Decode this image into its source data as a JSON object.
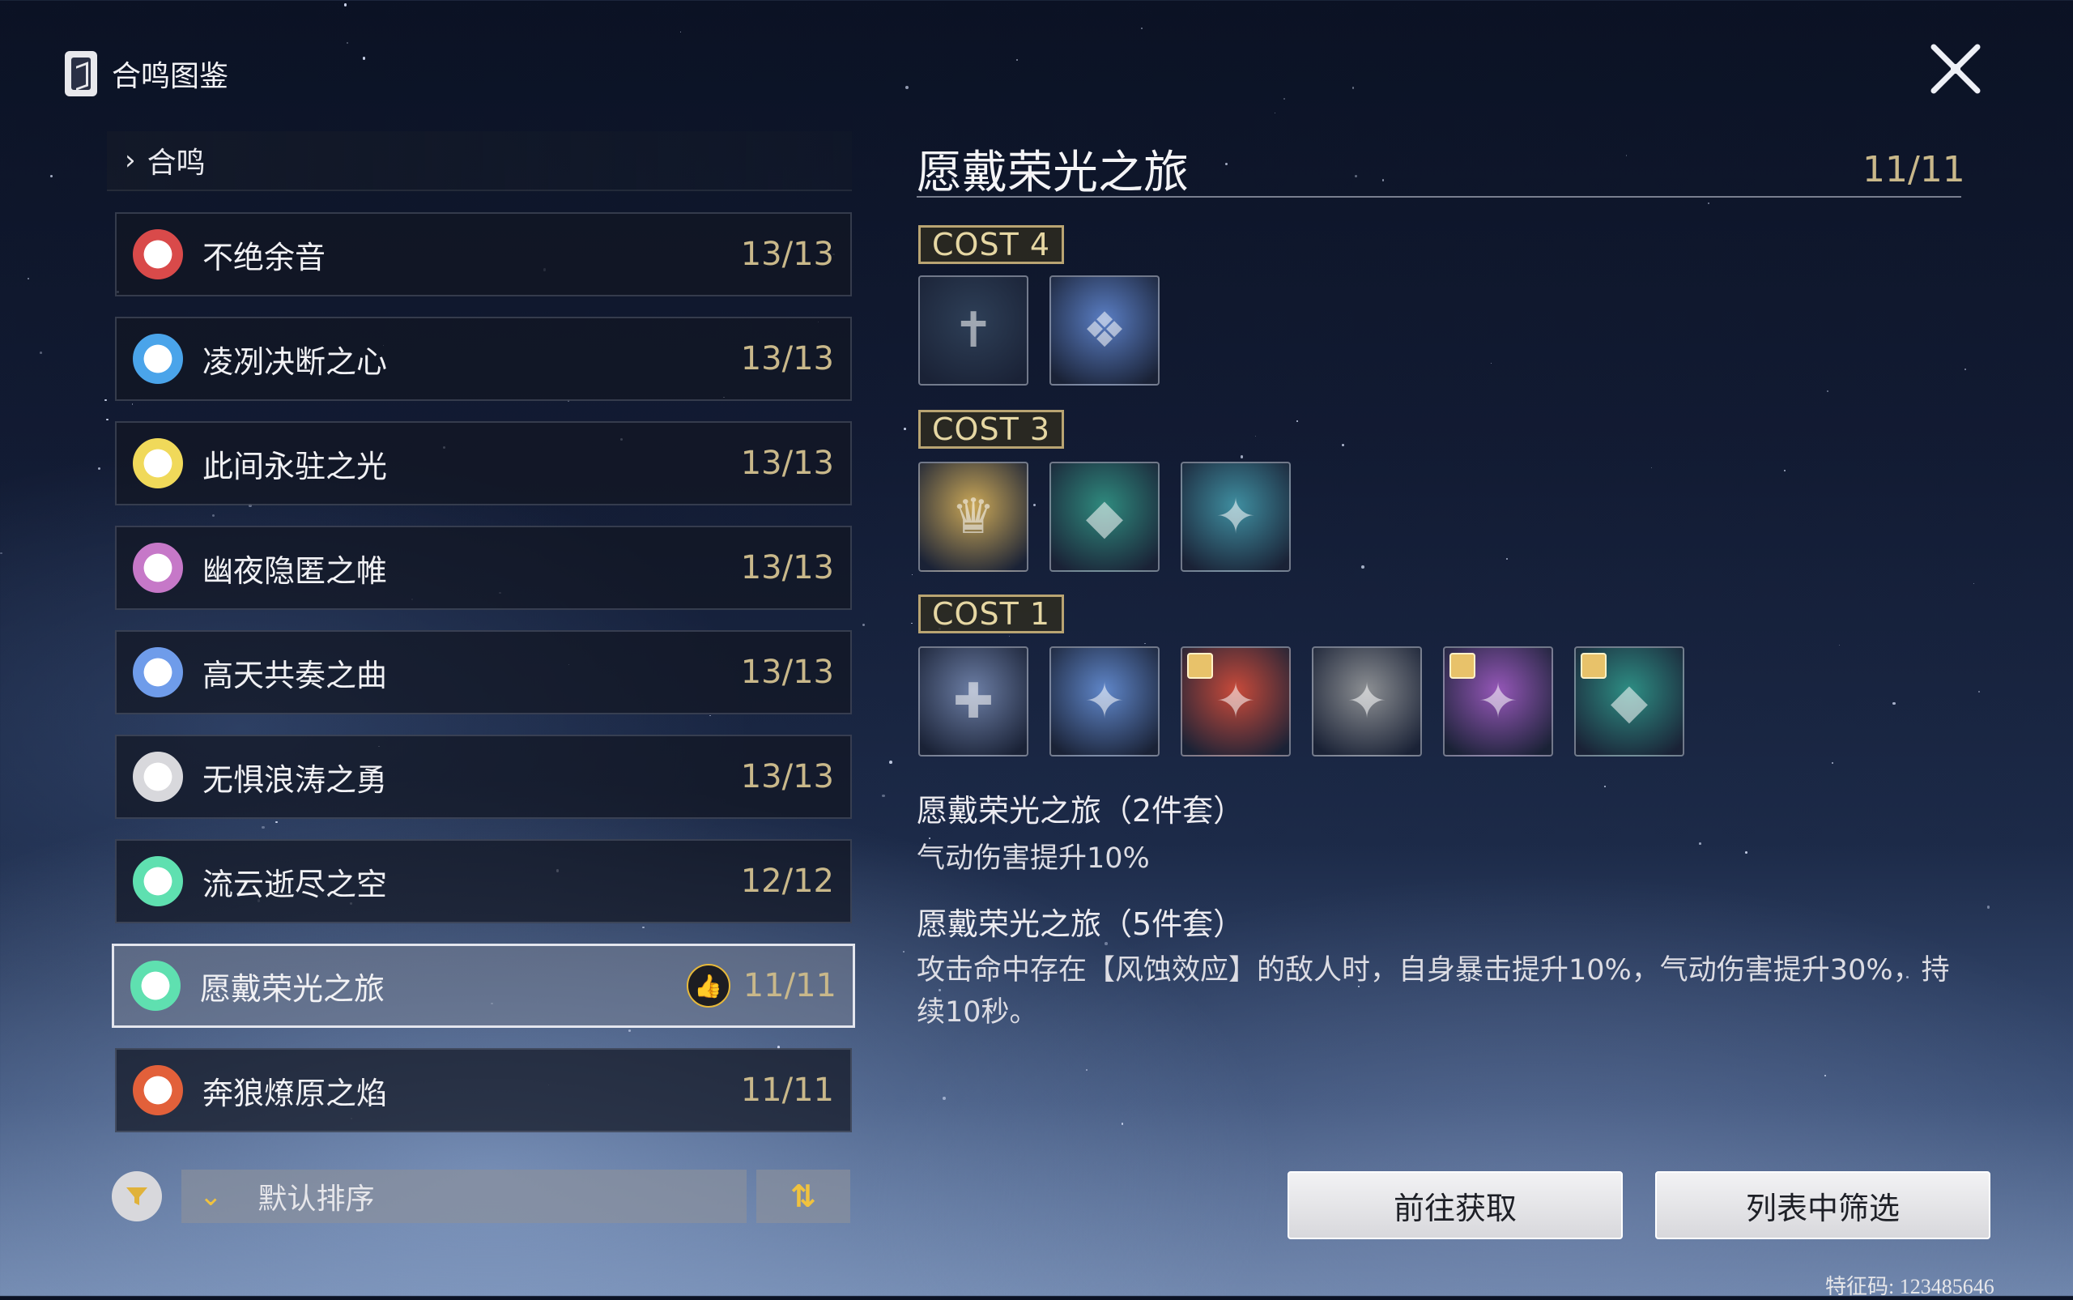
{
  "header": {
    "title": "合鸣图鉴",
    "icon": "codex-icon"
  },
  "list": {
    "category": "合鸣",
    "sets": [
      {
        "name": "不绝余音",
        "count": "13/13",
        "color": "#d94a4a",
        "icon": "sword-cross-icon"
      },
      {
        "name": "凌冽决断之心",
        "count": "13/13",
        "color": "#4aa4ea",
        "icon": "ice-star-icon"
      },
      {
        "name": "此间永驻之光",
        "count": "13/13",
        "color": "#f0d95a",
        "icon": "sun-icon"
      },
      {
        "name": "幽夜隐匿之帷",
        "count": "13/13",
        "color": "#c678c8",
        "icon": "shadow-icon"
      },
      {
        "name": "高天共奏之曲",
        "count": "13/13",
        "color": "#6f9cea",
        "icon": "sparkle-icon"
      },
      {
        "name": "无惧浪涛之勇",
        "count": "13/13",
        "color": "#d8d8dc",
        "icon": "wave-icon"
      },
      {
        "name": "流云逝尽之空",
        "count": "12/12",
        "color": "#5fe0b0",
        "icon": "wing-icon"
      },
      {
        "name": "愿戴荣光之旅",
        "count": "11/11",
        "color": "#5fe0b0",
        "icon": "fleur-icon",
        "selected": true,
        "recommended": true
      },
      {
        "name": "奔狼燎原之焰",
        "count": "11/11",
        "color": "#e2603a",
        "icon": "flame-icon"
      }
    ]
  },
  "sort": {
    "label": "默认排序",
    "order_symbol": "⇅"
  },
  "detail": {
    "title": "愿戴荣光之旅",
    "count": "11/11",
    "groups": [
      {
        "cost": "COST 4",
        "echoes": [
          {
            "name": "sword-echo",
            "bg": "#2e3f57",
            "sym": "✝",
            "badge": false
          },
          {
            "name": "dragon-echo",
            "bg": "#5a7ec4",
            "sym": "❖",
            "badge": false
          }
        ]
      },
      {
        "cost": "COST 3",
        "echoes": [
          {
            "name": "golden-knight-echo",
            "bg": "#caa757",
            "sym": "♛",
            "badge": false
          },
          {
            "name": "jade-guardian-echo",
            "bg": "#2f8a7e",
            "sym": "◆",
            "badge": false
          },
          {
            "name": "teal-drake-echo",
            "bg": "#3f8ea0",
            "sym": "✦",
            "badge": false
          }
        ]
      },
      {
        "cost": "COST 1",
        "echoes": [
          {
            "name": "hooded-echo",
            "bg": "#6c7ea5",
            "sym": "✚",
            "badge": false
          },
          {
            "name": "blue-drake-echo",
            "bg": "#5f86c9",
            "sym": "✦",
            "badge": false
          },
          {
            "name": "red-drake-echo",
            "bg": "#c84a3a",
            "sym": "✦",
            "badge": true
          },
          {
            "name": "white-drake-echo",
            "bg": "#8c8f93",
            "sym": "✦",
            "badge": false
          },
          {
            "name": "violet-drake-echo",
            "bg": "#9557b8",
            "sym": "✦",
            "badge": true
          },
          {
            "name": "jade-echo",
            "bg": "#2e8e84",
            "sym": "◆",
            "badge": true
          }
        ]
      }
    ],
    "effect2_title": "愿戴荣光之旅（2件套）",
    "effect2_desc": "气动伤害提升10%",
    "effect5_title": "愿戴荣光之旅（5件套）",
    "effect5_desc": "攻击命中存在【风蚀效应】的敌人时，自身暴击提升10%，气动伤害提升30%，持续10秒。"
  },
  "actions": {
    "acquire": "前往获取",
    "filter": "列表中筛选"
  },
  "watermark": "特征码: 123485646"
}
